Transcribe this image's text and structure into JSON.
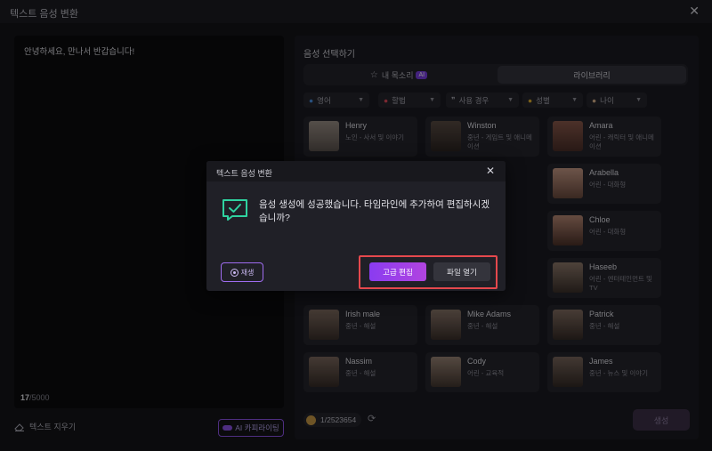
{
  "window": {
    "title": "텍스트 음성 변환"
  },
  "editor": {
    "text": "안녕하세요, 만나서 반갑습니다!",
    "count_current": "17",
    "count_max": "/5000"
  },
  "bottom_left": {
    "clear_label": "텍스트 지우기",
    "ai_label": "AI 카피라이팅"
  },
  "panel": {
    "title": "음성 선택하기",
    "tabs": [
      {
        "label": "내 목소리",
        "badge": "AI"
      },
      {
        "label": "라이브러리"
      }
    ],
    "filters": [
      "영어",
      "할법",
      "사용 경우",
      "성별",
      "나이"
    ],
    "voices": [
      {
        "name": "Henry",
        "desc": "노인 - 사서 및 이야기"
      },
      {
        "name": "Winston",
        "desc": "중년 - 게임트 및 애니메이션"
      },
      {
        "name": "Amara",
        "desc": "어린 - 캐릭터 및 애니메이션"
      },
      {
        "name": "Arabella",
        "desc": "어린 - 대화형"
      },
      {
        "name": "Chloe",
        "desc": "어린 - 대화형"
      },
      {
        "name": "Haseeb",
        "desc": "어린 - 엔터테인먼트 및 TV"
      },
      {
        "name": "Irish male",
        "desc": "중년 - 해설"
      },
      {
        "name": "Mike Adams",
        "desc": "중년 - 해설"
      },
      {
        "name": "Patrick",
        "desc": "중년 - 해설"
      },
      {
        "name": "Nassim",
        "desc": "중년 - 해설"
      },
      {
        "name": "Cody",
        "desc": "어린 - 교육적"
      },
      {
        "name": "James",
        "desc": "중년 - 뉴스 및 이야기"
      }
    ],
    "credits": "1/2523654",
    "generate_label": "생성"
  },
  "dialog": {
    "title": "텍스트 음성 변환",
    "message": "음성 생성에 성공했습니다. 타임라인에 추가하여 편집하시겠습니까?",
    "replay_label": "재생",
    "advanced_label": "고급 편집",
    "open_label": "파일 열기"
  },
  "colors": {
    "accent": "#8a3cf0",
    "highlight": "#e5484d",
    "success_icon": "#2fd3a0"
  },
  "icons": [
    "close-icon",
    "eraser-icon",
    "ai-sparkle-icon",
    "star-icon",
    "globe-icon",
    "flag-icon",
    "quote-icon",
    "gender-icon",
    "age-icon",
    "coin-icon",
    "refresh-icon",
    "check-message-icon",
    "play-icon"
  ]
}
